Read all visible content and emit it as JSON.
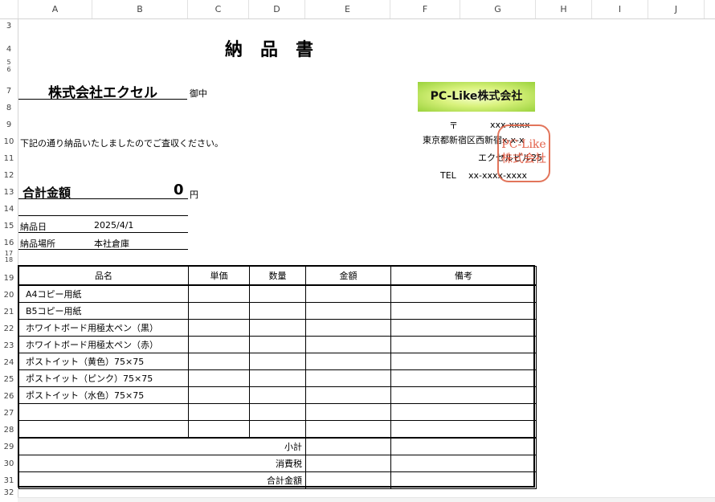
{
  "columns": [
    "A",
    "B",
    "C",
    "D",
    "E",
    "F",
    "G",
    "H",
    "I",
    "J"
  ],
  "rows": [
    "3",
    "4",
    "5",
    "6",
    "7",
    "8",
    "9",
    "10",
    "11",
    "12",
    "13",
    "14",
    "15",
    "16",
    "17",
    "18",
    "19",
    "20",
    "21",
    "22",
    "23",
    "24",
    "25",
    "26",
    "27",
    "28",
    "29",
    "30",
    "31",
    "32"
  ],
  "doc": {
    "title": "納品書",
    "recipient": "株式会社エクセル",
    "honorific": "御中",
    "intro": "下記の通り納品いたしましたのでご査収ください。",
    "total_label": "合計金額",
    "total_value": "0",
    "total_unit": "円",
    "delivery_date_label": "納品日",
    "delivery_date": "2025/4/1",
    "delivery_place_label": "納品場所",
    "delivery_place": "本社倉庫"
  },
  "sender": {
    "logo_text": "PC-Like株式会社",
    "postal_mark": "〒",
    "postal_code": "xxx-xxxx",
    "address": "東京都新宿区西新宿x-x-x",
    "building": "エクセルビル25",
    "tel_label": "TEL",
    "tel": "xx-xxxx-xxxx",
    "stamp_line1": "PC-Like",
    "stamp_line2": "株式会社"
  },
  "table": {
    "headers": [
      "品名",
      "単価",
      "数量",
      "金額",
      "備考"
    ],
    "items": [
      "A4コピー用紙",
      "B5コピー用紙",
      "ホワイトボード用極太ペン（黒）",
      "ホワイトボード用極太ペン（赤）",
      "ポストイット（黄色）75×75",
      "ポストイット（ピンク）75×75",
      "ポストイット（水色）75×75",
      "",
      ""
    ],
    "subtotal_label": "小計",
    "tax_label": "消費税",
    "grand_total_label": "合計金額"
  },
  "colors": {
    "stamp": "#e0533a",
    "logo": "#c8eb5a"
  }
}
